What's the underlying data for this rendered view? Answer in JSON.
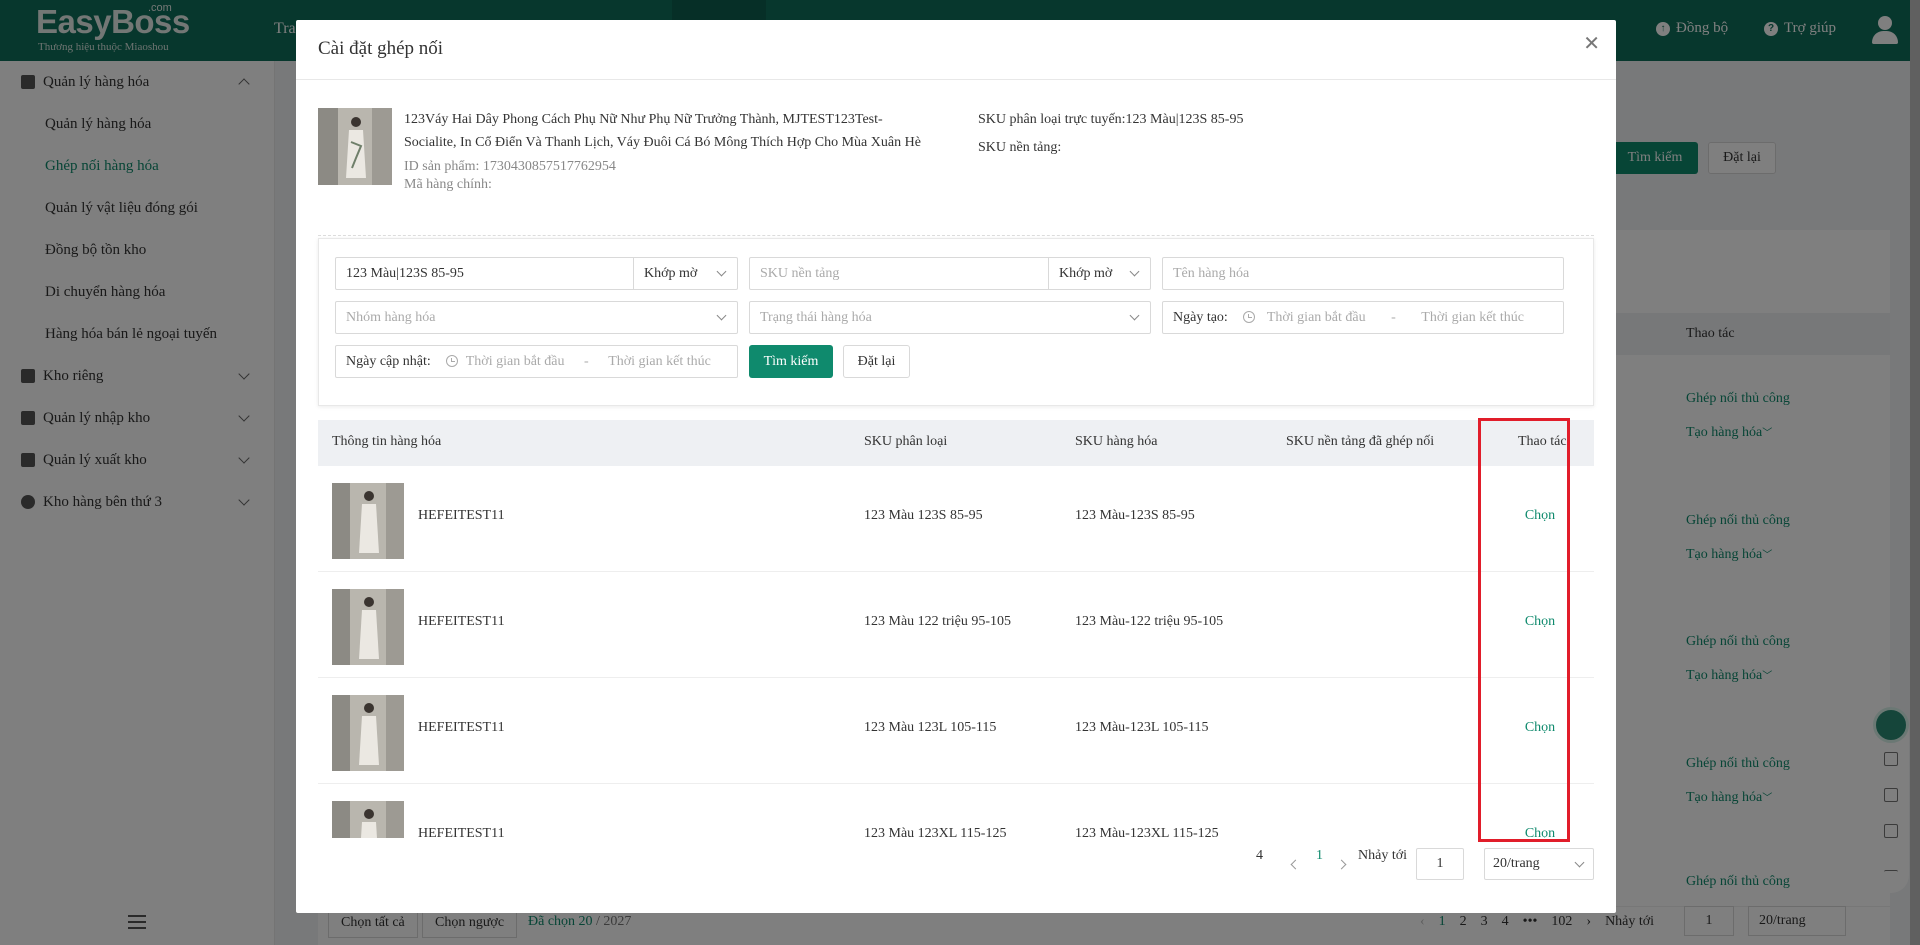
{
  "app": {
    "logo": "EasyBoss",
    "logo_suffix": ".com",
    "logo_sub": "Thương hiệu thuộc Miaoshou",
    "topnav_partial": "Tra",
    "sync": "Đồng bộ",
    "help": "Trợ giúp"
  },
  "sidebar": {
    "group_goods": "Quản lý hàng hóa",
    "items": [
      {
        "label": "Quản lý hàng hóa"
      },
      {
        "label": "Ghép nối hàng hóa"
      },
      {
        "label": "Quản lý vật liệu đóng gói"
      },
      {
        "label": "Đồng bộ tồn kho"
      },
      {
        "label": "Di chuyển hàng hóa"
      },
      {
        "label": "Hàng hóa bán lẻ ngoại tuyến"
      }
    ],
    "groups": [
      {
        "label": "Kho riêng"
      },
      {
        "label": "Quản lý nhập kho"
      },
      {
        "label": "Quản lý xuất kho"
      },
      {
        "label": "Kho hàng bên thứ 3"
      }
    ]
  },
  "background": {
    "search": "Tìm kiếm",
    "reset": "Đặt lại",
    "col_ops": "Thao tác",
    "op_manual": "Ghép nối thủ công",
    "op_create": "Tạo hàng hóa",
    "select_all": "Chọn tất cả",
    "invert": "Chọn ngược",
    "selected_prefix": "Đã chọn",
    "selected_count": "20",
    "selected_total": "/ 2027",
    "pages": [
      "1",
      "2",
      "3",
      "4",
      "•••",
      "102"
    ],
    "jump_label": "Nhảy tới",
    "jump_value": "1",
    "page_size": "20/trang"
  },
  "modal": {
    "title": "Cài đặt ghép nối",
    "product": {
      "name_line1": "123Váy Hai Dây Phong Cách Phụ Nữ Như Phụ Nữ Trưởng Thành, MJTEST123Test-",
      "name_line2": "Socialite, In Cổ Điển Và Thanh Lịch, Váy Đuôi Cá Bó Mông Thích Hợp Cho Mùa Xuân Hè",
      "id_label": "ID sản phẩm: 1730430857517762954",
      "main_code_label": "Mã hàng chính:",
      "sku_online": "SKU phân loại trực tuyến:123 Màu|123S 85-95",
      "sku_platform": "SKU nền tảng:"
    },
    "filters": {
      "sku_value": "123 Màu|123S 85-95",
      "match1": "Khớp mờ",
      "platform_sku_ph": "SKU nền tảng",
      "match2": "Khớp mờ",
      "goods_name_ph": "Tên hàng hóa",
      "group_ph": "Nhóm hàng hóa",
      "status_ph": "Trạng thái hàng hóa",
      "created_label": "Ngày tạo:",
      "start_ph": "Thời gian bắt đầu",
      "dash": "-",
      "end_ph": "Thời gian kết thúc",
      "updated_label": "Ngày cập nhật:",
      "search": "Tìm kiếm",
      "reset": "Đặt lại"
    },
    "columns": [
      "Thông tin hàng hóa",
      "SKU phân loại",
      "SKU hàng hóa",
      "SKU nền tảng đã ghép nối",
      "Thao tác"
    ],
    "rows": [
      {
        "name": "HEFEITEST11",
        "sku_class": "123 Màu 123S 85-95",
        "sku_goods": "123 Màu-123S 85-95",
        "action": "Chọn"
      },
      {
        "name": "HEFEITEST11",
        "sku_class": "123 Màu 122 triệu 95-105",
        "sku_goods": "123 Màu-122 triệu 95-105",
        "action": "Chọn"
      },
      {
        "name": "HEFEITEST11",
        "sku_class": "123 Màu 123L 105-115",
        "sku_goods": "123 Màu-123L 105-115",
        "action": "Chọn"
      },
      {
        "name": "HEFEITEST11",
        "sku_class": "123 Màu 123XL 115-125",
        "sku_goods": "123 Màu-123XL 115-125",
        "action": "Chọn"
      }
    ],
    "pagination": {
      "total": "4",
      "current": "1",
      "jump_label": "Nhảy tới",
      "jump_value": "1",
      "page_size": "20/trang"
    }
  },
  "colors": {
    "brand": "#0f6f5b",
    "accent": "#0f8a6d",
    "highlight": "#e11d2a"
  }
}
